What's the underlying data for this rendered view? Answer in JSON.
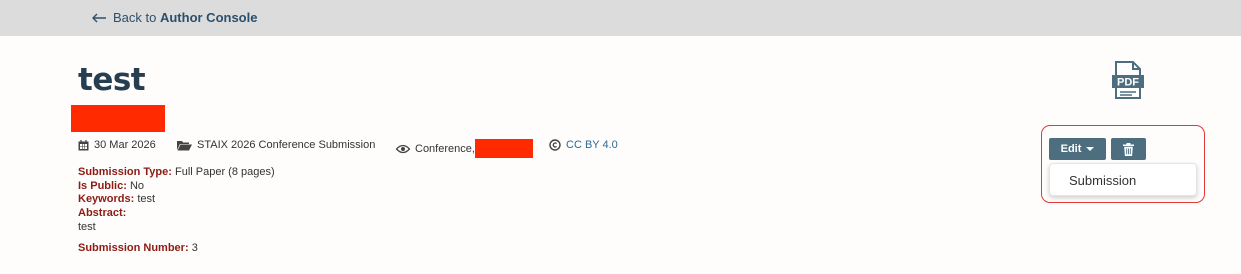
{
  "nav": {
    "back_prefix": "Back to ",
    "back_target": "Author Console"
  },
  "submission": {
    "title": "test",
    "date": "30 Mar 2026",
    "venue": "STAIX 2026 Conference Submission",
    "readers": "Conference,",
    "license": "CC BY 4.0"
  },
  "fields": {
    "type_label": "Submission Type:",
    "type_value": "Full Paper (8 pages)",
    "public_label": "Is Public:",
    "public_value": "No",
    "keywords_label": "Keywords:",
    "keywords_value": "test",
    "abstract_label": "Abstract:",
    "abstract_value": "test",
    "number_label": "Submission Number:",
    "number_value": "3"
  },
  "pdf": {
    "label": "PDF"
  },
  "actions": {
    "edit_label": "Edit",
    "dropdown_items": [
      "Submission"
    ]
  },
  "colors": {
    "topbar": "#dcdcdc",
    "field_label": "#8c1b13",
    "button": "#4d6e7f",
    "title": "#263e50",
    "redaction": "#ff2a00"
  }
}
